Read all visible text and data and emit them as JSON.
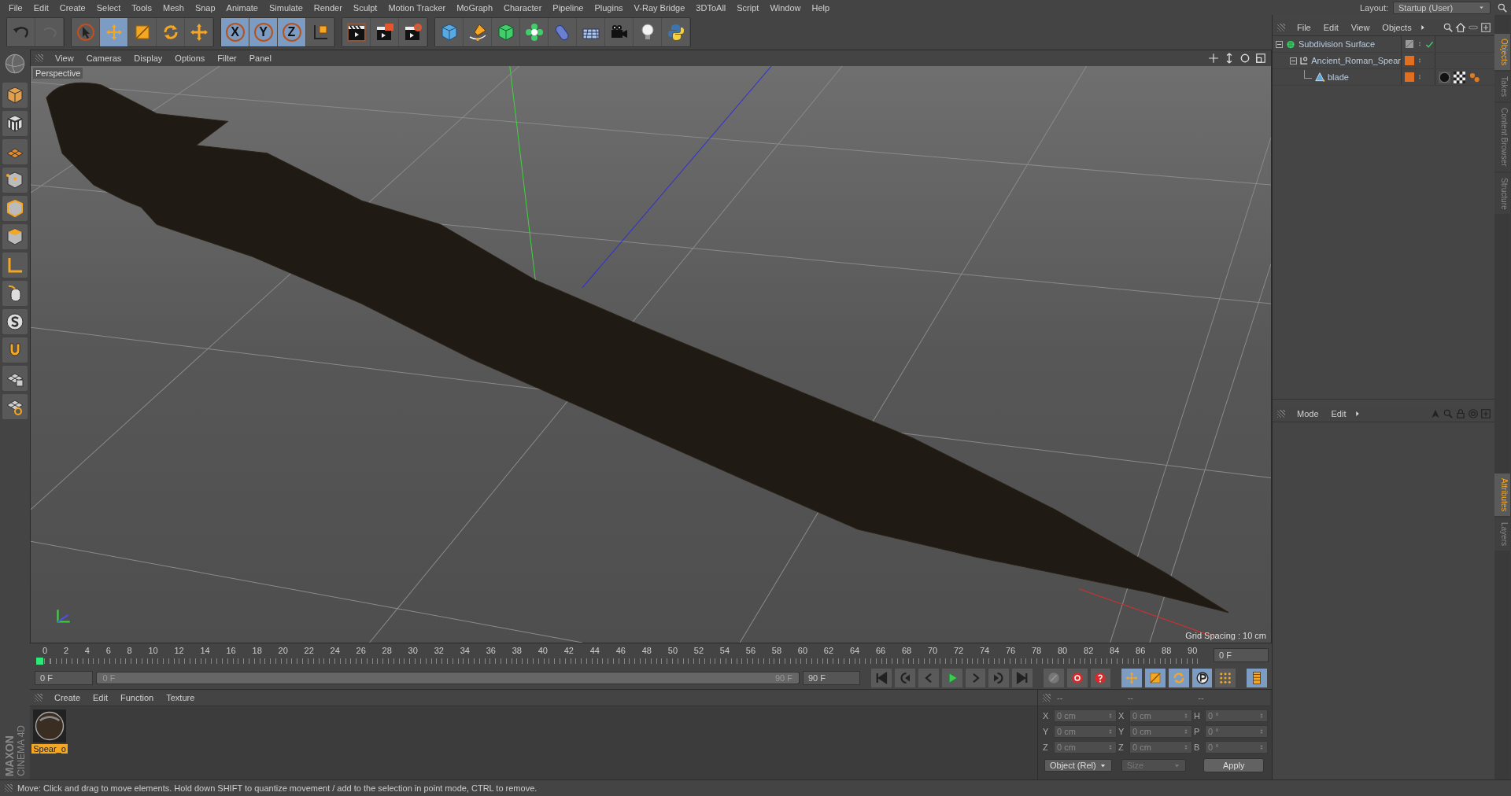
{
  "menu_bar": {
    "items": [
      "File",
      "Edit",
      "Create",
      "Select",
      "Tools",
      "Mesh",
      "Snap",
      "Animate",
      "Simulate",
      "Render",
      "Sculpt",
      "Motion Tracker",
      "MoGraph",
      "Character",
      "Pipeline",
      "Plugins",
      "V-Ray Bridge",
      "3DToAll",
      "Script",
      "Window",
      "Help"
    ],
    "layout": {
      "label": "Layout:",
      "value": "Startup (User)"
    }
  },
  "toolbar": {
    "tools": [
      {
        "kind": "undo",
        "selected": false
      },
      {
        "kind": "redo",
        "selected": false
      },
      {
        "kind": "select",
        "selected": false
      },
      {
        "kind": "move",
        "selected": true
      },
      {
        "kind": "scale",
        "selected": false
      },
      {
        "kind": "rotate",
        "selected": false
      },
      {
        "kind": "add",
        "selected": false
      },
      {
        "kind": "axis",
        "label": "X",
        "selected": true
      },
      {
        "kind": "axis",
        "label": "Y",
        "selected": true
      },
      {
        "kind": "axis",
        "label": "Z",
        "selected": true
      },
      {
        "kind": "world",
        "selected": false
      },
      {
        "kind": "render-view",
        "selected": false
      },
      {
        "kind": "render",
        "selected": false
      },
      {
        "kind": "render-settings",
        "selected": false
      },
      {
        "kind": "cube",
        "selected": false
      },
      {
        "kind": "pen",
        "selected": false
      },
      {
        "kind": "subdiv",
        "selected": false
      },
      {
        "kind": "cloner",
        "selected": false
      },
      {
        "kind": "deformer",
        "selected": false
      },
      {
        "kind": "floor",
        "selected": false
      },
      {
        "kind": "camera",
        "selected": false
      },
      {
        "kind": "light",
        "selected": false
      },
      {
        "kind": "python",
        "selected": false
      }
    ]
  },
  "viewport": {
    "menu": [
      "View",
      "Cameras",
      "Display",
      "Options",
      "Filter",
      "Panel"
    ],
    "camera": "Perspective",
    "grid_spacing": "Grid Spacing : 10 cm"
  },
  "timeline": {
    "frames": [
      "0",
      "2",
      "4",
      "6",
      "8",
      "10",
      "12",
      "14",
      "16",
      "18",
      "20",
      "22",
      "24",
      "26",
      "28",
      "30",
      "32",
      "34",
      "36",
      "38",
      "40",
      "42",
      "44",
      "46",
      "48",
      "50",
      "52",
      "54",
      "56",
      "58",
      "60",
      "62",
      "64",
      "66",
      "68",
      "70",
      "72",
      "74",
      "76",
      "78",
      "80",
      "82",
      "84",
      "86",
      "88",
      "90"
    ],
    "current_frame": "0 F",
    "start_field": "0 F",
    "range": {
      "start": "0 F",
      "end": "90 F",
      "level": 1
    },
    "end_field": "90 F"
  },
  "materials": {
    "menu": [
      "Create",
      "Edit",
      "Function",
      "Texture"
    ],
    "items": [
      {
        "name": "Spear_o",
        "selected": true
      }
    ]
  },
  "coordinates": {
    "headers": [
      "--",
      "--",
      "--"
    ],
    "rows": [
      {
        "axis": "X",
        "position": "0 cm",
        "size_axis": "X",
        "size": "0 cm",
        "rot_axis": "H",
        "rotation": "0 °"
      },
      {
        "axis": "Y",
        "position": "0 cm",
        "size_axis": "Y",
        "size": "0 cm",
        "rot_axis": "P",
        "rotation": "0 °"
      },
      {
        "axis": "Z",
        "position": "0 cm",
        "size_axis": "Z",
        "size": "0 cm",
        "rot_axis": "B",
        "rotation": "0 °"
      }
    ],
    "mode": "Object (Rel)",
    "size_mode": "Size",
    "apply": "Apply"
  },
  "objects": {
    "menu": [
      "File",
      "Edit",
      "View",
      "Objects"
    ],
    "tree": [
      {
        "name": "Subdivision Surface",
        "kind": "generator",
        "expanded": true,
        "children": [
          {
            "name": "Ancient_Roman_Spear",
            "kind": "null",
            "expanded": true,
            "children": [
              {
                "name": "blade",
                "kind": "polygon",
                "tags": [
                  {
                    "kind": "material"
                  },
                  {
                    "kind": "checker"
                  },
                  {
                    "kind": "phong"
                  }
                ]
              }
            ]
          }
        ]
      }
    ]
  },
  "attributes": {
    "menu": [
      "Mode",
      "Edit"
    ]
  },
  "side_tabs": {
    "top": [
      {
        "label": "Objects",
        "selected": true
      },
      {
        "label": "Takes",
        "selected": false
      },
      {
        "label": "Content Browser",
        "selected": false
      },
      {
        "label": "Structure",
        "selected": false
      }
    ],
    "bottom": [
      {
        "label": "Attributes",
        "selected": true
      },
      {
        "label": "Layers",
        "selected": false
      }
    ]
  },
  "logo": {
    "brand": "MAXON",
    "product": "CINEMA 4D"
  },
  "status_bar": "Move: Click and drag to move elements. Hold down SHIFT to quantize movement / add to the selection in point mode, CTRL to remove."
}
